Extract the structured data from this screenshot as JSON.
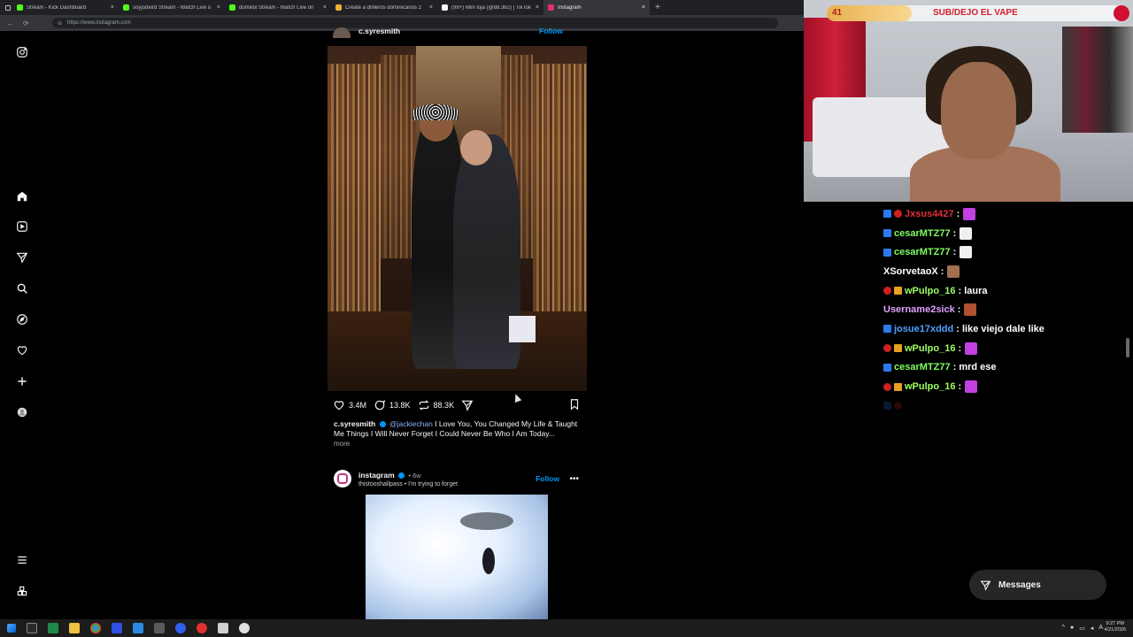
{
  "browser": {
    "tabs": [
      {
        "title": "Stream - Kick Dashboard",
        "color": "#53fc18"
      },
      {
        "title": "soyjodeird Stream - Watch Live o",
        "color": "#53fc18"
      },
      {
        "title": "domiilol Stream - Watch Live on",
        "color": "#53fc18"
      },
      {
        "title": "Create a drilleros dominicanos 2",
        "color": "#f0b030"
      },
      {
        "title": "(99+) Mini loja (@88.362) | TikTok",
        "color": "#ffffff"
      },
      {
        "title": "Instagram",
        "color": "#e1306c"
      }
    ],
    "url": "https://www.instagram.com"
  },
  "post1": {
    "author_top": "c.syresmith",
    "follow_top": "Follow",
    "likes": "3.4M",
    "comments": "13.8K",
    "reposts": "88.3K",
    "caption_user": "c.syresmith",
    "caption_mention": "@jackiechan",
    "caption_text": "I Love You, You Changed My Life & Taught Me Things I Will Never Forget I Could Never Be Who I Am Today...",
    "more": "more"
  },
  "post2": {
    "author": "instagram",
    "time": "• 6w",
    "subtitle": "thistooshallpass • I'm trying to forget",
    "follow": "Follow",
    "menu": "•••"
  },
  "stream": {
    "viewer_count": "41",
    "banner": "SUB/DEJO EL VAPE"
  },
  "chat": [
    {
      "user": "Jxsus4427",
      "badges": [
        "kick",
        "red"
      ],
      "color": "#e0303a",
      "text": ":",
      "emote": "#c040e0"
    },
    {
      "user": "cesarMTZ77",
      "badges": [
        "kick"
      ],
      "color": "#7cff60",
      "text": ":",
      "emote": "#f0f0f0"
    },
    {
      "user": "cesarMTZ77",
      "badges": [
        "kick"
      ],
      "color": "#7cff60",
      "text": ":",
      "emote": "#f0f0f0"
    },
    {
      "user": "XSorvetaoX",
      "badges": [],
      "color": "#ffffff",
      "text": ":",
      "emote": "#a07050"
    },
    {
      "user": "wPulpo_16",
      "badges": [
        "red",
        "sub"
      ],
      "color": "#9cff60",
      "text": ": laura",
      "emote": ""
    },
    {
      "user": "Username2sick",
      "badges": [],
      "color": "#e0a0ff",
      "text": ":",
      "emote": "#b05030"
    },
    {
      "user": "josue17xddd",
      "badges": [
        "kick"
      ],
      "color": "#50a0ff",
      "text": ": like viejo dale like",
      "emote": ""
    },
    {
      "user": "wPulpo_16",
      "badges": [
        "red",
        "sub"
      ],
      "color": "#9cff60",
      "text": ":",
      "emote": "#c040e0"
    },
    {
      "user": "cesarMTZ77",
      "badges": [
        "kick"
      ],
      "color": "#7cff60",
      "text": ": mrd ese",
      "emote": ""
    },
    {
      "user": "wPulpo_16",
      "badges": [
        "red",
        "sub"
      ],
      "color": "#9cff60",
      "text": ":",
      "emote": "#c040e0"
    }
  ],
  "messages_button": "Messages",
  "taskbar": {
    "time": "9:27 PM",
    "date": "4/21/2026"
  }
}
